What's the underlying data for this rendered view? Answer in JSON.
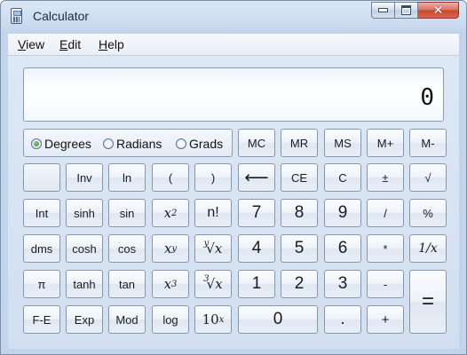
{
  "window": {
    "title": "Calculator",
    "icon": "calculator-icon"
  },
  "menu": [
    {
      "label": "View",
      "accel": "V"
    },
    {
      "label": "Edit",
      "accel": "E"
    },
    {
      "label": "Help",
      "accel": "H"
    }
  ],
  "display": {
    "value": "0"
  },
  "angle_units": {
    "options": [
      "Degrees",
      "Radians",
      "Grads"
    ],
    "selected": "Degrees"
  },
  "buttons": {
    "mc": "MC",
    "mr": "MR",
    "ms": "MS",
    "mplus": "M+",
    "mminus": "M-",
    "inv": "Inv",
    "ln": "ln",
    "lparen": "(",
    "rparen": ")",
    "backspace": "⟵",
    "ce": "CE",
    "c": "C",
    "plusminus": "±",
    "sqrt": "√",
    "int": "Int",
    "sinh": "sinh",
    "sin": "sin",
    "x2_base": "x",
    "x2_exp": "2",
    "nfact": "n!",
    "d7": "7",
    "d8": "8",
    "d9": "9",
    "div": "/",
    "pct": "%",
    "dms": "dms",
    "cosh": "cosh",
    "cos": "cos",
    "xy_base": "x",
    "xy_exp": "y",
    "yroot_pre": "y",
    "yroot": "√x",
    "d4": "4",
    "d5": "5",
    "d6": "6",
    "mul": "*",
    "recip": "1/x",
    "pi": "π",
    "tanh": "tanh",
    "tan": "tan",
    "x3_base": "x",
    "x3_exp": "3",
    "cbrt_pre": "3",
    "cbrt": "√x",
    "d1": "1",
    "d2": "2",
    "d3": "3",
    "sub": "-",
    "eq": "=",
    "fe": "F-E",
    "exp": "Exp",
    "mod": "Mod",
    "log": "log",
    "tenx_base": "10",
    "tenx_exp": "x",
    "d0": "0",
    "dot": ".",
    "add": "+"
  },
  "colors": {
    "accent": "#c2d4ec",
    "close": "#c7452b"
  }
}
